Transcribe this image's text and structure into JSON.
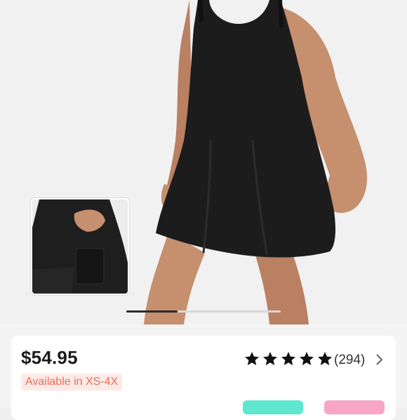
{
  "product": {
    "price": "$54.95",
    "availability": "Available in XS-4X",
    "rating": {
      "stars": 5,
      "filled": 5,
      "review_count": "(294)"
    },
    "description_partial": ""
  },
  "gallery": {
    "slide_progress": 0.33,
    "main_image": "model-black-dress",
    "thumbnail_image": "dress-pocket-detail"
  },
  "colors": {
    "accent_text": "#e2705c",
    "accent_bg": "#fdeae6",
    "badge_teal": "#5ee6cf",
    "badge_pink": "#f7a6c4"
  }
}
